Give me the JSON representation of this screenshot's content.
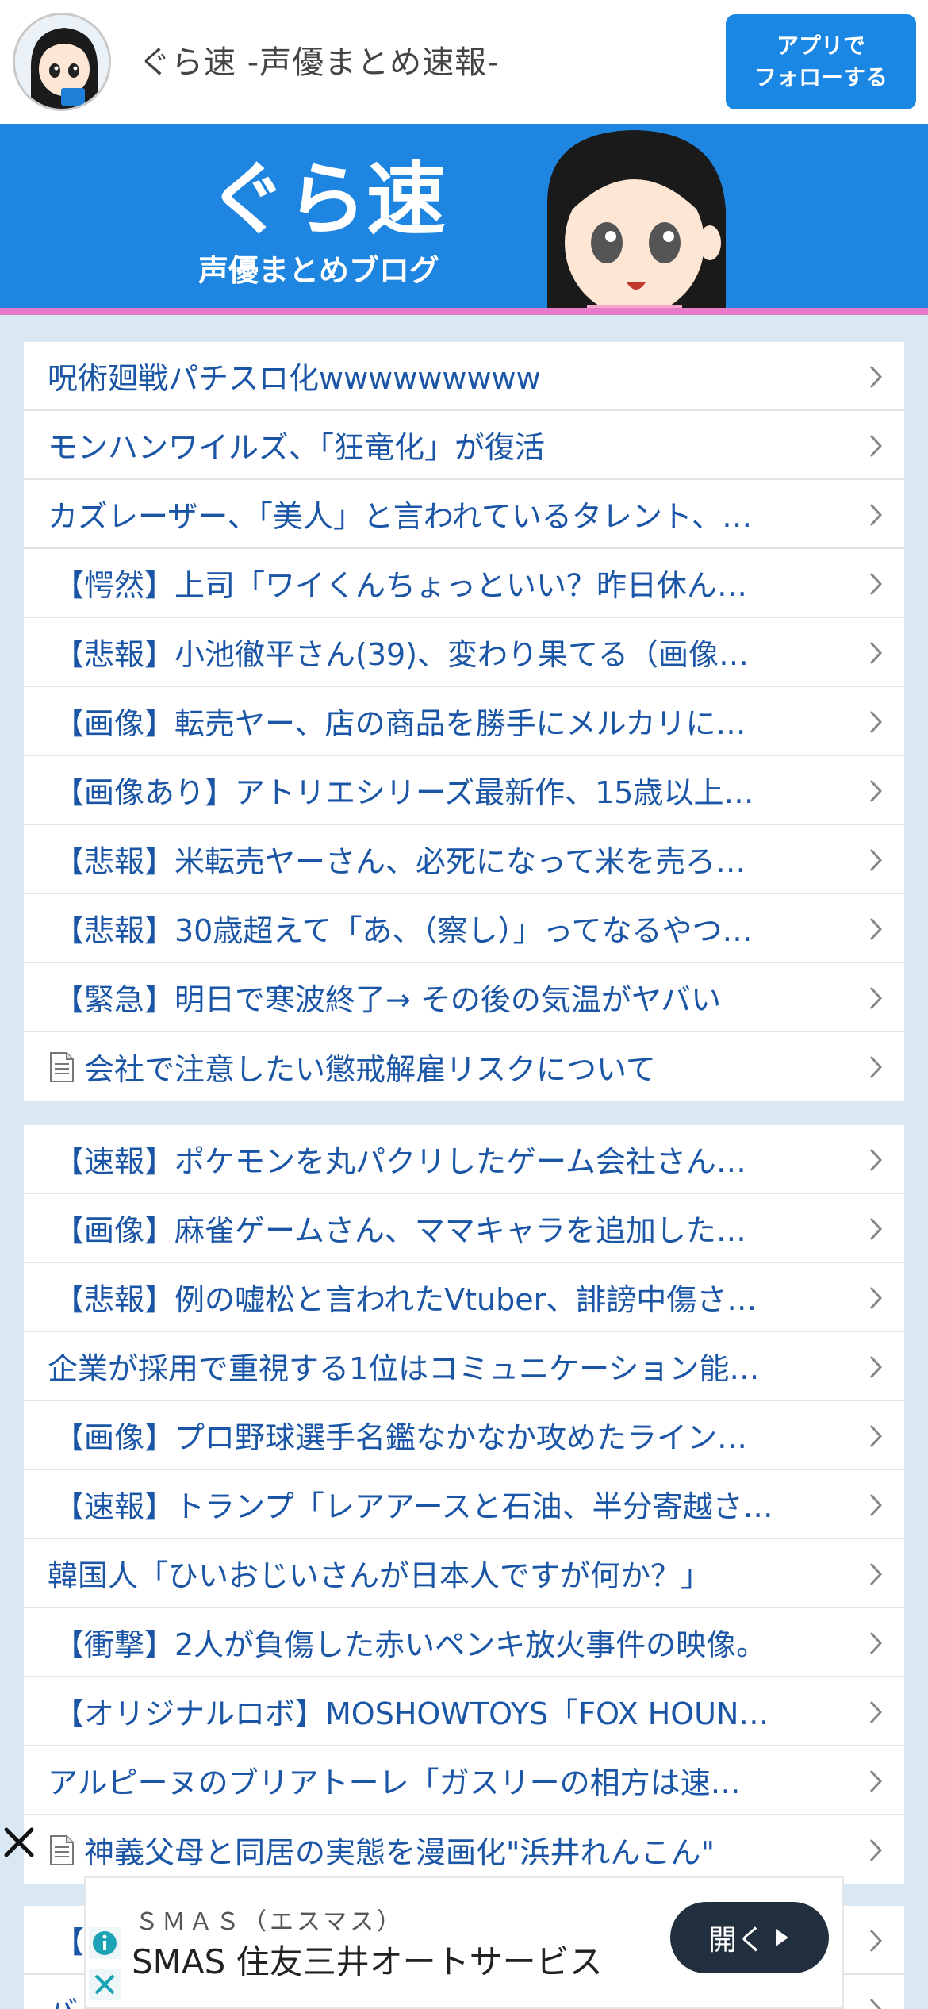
{
  "header": {
    "site_title": "ぐら速 -声優まとめ速報-",
    "follow_button_label": "アプリで\nフォローする"
  },
  "banner": {
    "title": "ぐら速",
    "subtitle": "声優まとめブログ"
  },
  "list1": {
    "items": [
      {
        "label": "呪術廻戦パチスロ化wwwwwwwww",
        "type": "plain"
      },
      {
        "label": "モンハンワイルズ、「狂竜化」が復活",
        "type": "plain"
      },
      {
        "label": "カズレーザー、「美人」と言われているタレント、…",
        "type": "plain"
      },
      {
        "label": "【愕然】上司「ワイくんちょっといい？昨日休ん…",
        "type": "bracket"
      },
      {
        "label": "【悲報】小池徹平さん(39)、変わり果てる（画像…",
        "type": "bracket"
      },
      {
        "label": "【画像】転売ヤー、店の商品を勝手にメルカリに…",
        "type": "bracket"
      },
      {
        "label": "【画像あり】アトリエシリーズ最新作、15歳以上…",
        "type": "bracket"
      },
      {
        "label": "【悲報】米転売ヤーさん、必死になって米を売ろ…",
        "type": "bracket"
      },
      {
        "label": "【悲報】30歳超えて「あ、（察し）」ってなるやつ…",
        "type": "bracket"
      },
      {
        "label": "【緊急】明日で寒波終了→ その後の気温がヤバい",
        "type": "bracket"
      },
      {
        "label": "会社で注意したい懲戒解雇リスクについて",
        "type": "doc"
      }
    ]
  },
  "list2": {
    "items": [
      {
        "label": "【速報】ポケモンを丸パクリしたゲーム会社さん…",
        "type": "bracket"
      },
      {
        "label": "【画像】麻雀ゲームさん、ママキャラを追加した…",
        "type": "bracket"
      },
      {
        "label": "【悲報】例の嘘松と言われたVtuber、誹謗中傷さ…",
        "type": "bracket"
      },
      {
        "label": "企業が採用で重視する1位はコミュニケーション能…",
        "type": "plain"
      },
      {
        "label": "【画像】プロ野球選手名鑑なかなか攻めたライン…",
        "type": "bracket"
      },
      {
        "label": "【速報】トランプ「レアアースと石油、半分寄越さ…",
        "type": "bracket"
      },
      {
        "label": "韓国人「ひいおじいさんが日本人ですが何か？」",
        "type": "plain"
      },
      {
        "label": "【衝撃】2人が負傷した赤いペンキ放火事件の映像。",
        "type": "bracket"
      },
      {
        "label": "【オリジナルロボ】MOSHOWTOYS「FOX HOUN…",
        "type": "bracket"
      },
      {
        "label": "アルピーヌのブリアトーレ「ガスリーの相方は速…",
        "type": "plain"
      },
      {
        "label": "神義父母と同居の実態を漫画化\"浜井れんこん\"",
        "type": "doc"
      }
    ]
  },
  "list3": {
    "items": [
      {
        "label": "【",
        "type": "bracket"
      },
      {
        "label": "バーナマンから与田ちゃんへの卒業祝いのプレゼ",
        "type": "plain"
      }
    ]
  },
  "ad": {
    "sponsor": "ＳＭＡＳ（エスマス）",
    "title": "SMAS 住友三井オートサービス",
    "open_label": "開く"
  },
  "colors": {
    "accent": "#1a87e5",
    "link": "#1a55a6",
    "banner_bg": "#1e86e0",
    "banner_strip": "#e77bc9",
    "page_bg": "#d9e8f2"
  }
}
